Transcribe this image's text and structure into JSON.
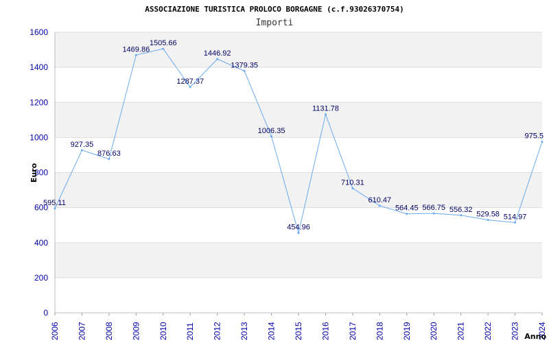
{
  "chart_data": {
    "type": "line",
    "title": "ASSOCIAZIONE TURISTICA PROLOCO BORGAGNE (c.f.93026370754)",
    "subtitle": "Importi",
    "xlabel": "Anno",
    "ylabel": "Euro",
    "ylim": [
      0,
      1600
    ],
    "yticks": [
      0,
      200,
      400,
      600,
      800,
      1000,
      1200,
      1400,
      1600
    ],
    "grid": true,
    "colors": {
      "line": "#6aaaf0",
      "band": "#f2f2f2",
      "tick": "#0000aa",
      "label": "#000066"
    },
    "x": [
      "2006",
      "2007",
      "2008",
      "2009",
      "2010",
      "2011",
      "2012",
      "2013",
      "2014",
      "2015",
      "2016",
      "2017",
      "2018",
      "2019",
      "2020",
      "2021",
      "2022",
      "2023",
      "2024"
    ],
    "series": [
      {
        "values": [
          595.11,
          927.35,
          876.63,
          1469.86,
          1505.66,
          1287.37,
          1446.92,
          1379.35,
          1006.35,
          454.96,
          1131.78,
          710.31,
          610.47,
          564.45,
          566.75,
          556.32,
          529.58,
          514.97,
          975.5
        ],
        "labels": [
          "595.11",
          "927.35",
          "876.63",
          "1469.86",
          "1505.66",
          "1287.37",
          "1446.92",
          "1379.35",
          "1006.35",
          "454.96",
          "1131.78",
          "710.31",
          "610.47",
          "564.45",
          "566.75",
          "556.32",
          "529.58",
          "514.97",
          "975.5"
        ]
      }
    ]
  }
}
